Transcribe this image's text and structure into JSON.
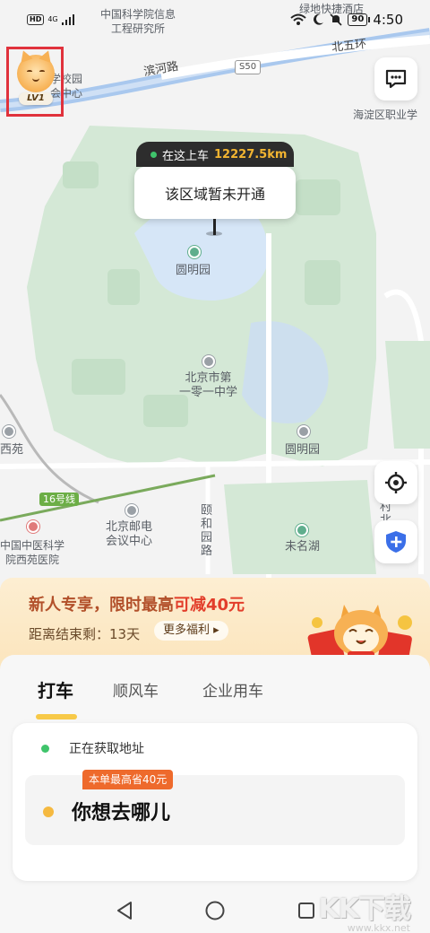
{
  "status_bar": {
    "hd": "HD",
    "network": "4G",
    "battery": "90",
    "time": "4:50"
  },
  "map": {
    "labels": {
      "research_institute": "中国科学院信息\n工程研究所",
      "hotel": "绿地快捷酒店",
      "school_campus": "学校园\n会中心",
      "binhe_road": "滨河路",
      "s50": "S50",
      "north_5th_ring": "北五环",
      "haidian_school": "海淀区职业学",
      "yuanmingyuan": "圆明园",
      "middle_school": "北京市第\n一零一中学",
      "xiyuan": "西苑",
      "yuanmingyuan_station": "圆明园",
      "line16": "16号线",
      "post_conference": "北京邮电\n会议中心",
      "yiheyuan_road": "颐\n和\n园\n路",
      "village_north": "村\n北",
      "tcm_hospital": "中国中医科学\n院西苑医院",
      "weiming_lake": "未名湖"
    }
  },
  "avatar": {
    "level": "LV1"
  },
  "pickup": {
    "tag_text": "在这上车",
    "distance": "12227.5km",
    "message": "该区域暂未开通"
  },
  "promo": {
    "title_main": "新人专享，限时最高",
    "title_highlight": "可减40元",
    "countdown": "距离结束剩：13天",
    "more_benefits": "更多福利"
  },
  "tabs": [
    {
      "label": "打车"
    },
    {
      "label": "顺风车"
    },
    {
      "label": "企业用车"
    }
  ],
  "ride": {
    "current_location": "正在获取地址",
    "save_tag": "本单最高省40元",
    "destination_placeholder": "你想去哪儿"
  },
  "watermark": {
    "logo": "KK下载",
    "url": "www.kkx.net"
  }
}
